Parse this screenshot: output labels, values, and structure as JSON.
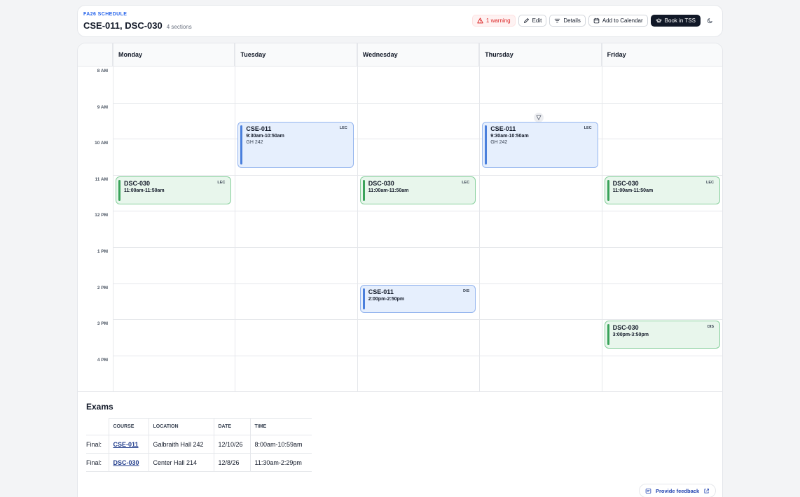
{
  "header": {
    "eyebrow": "FA26 SCHEDULE",
    "title": "CSE-011, DSC-030",
    "subtitle": "4 sections",
    "warning_label": "1 warning",
    "edit_label": "Edit",
    "details_label": "Details",
    "calendar_label": "Add to Calendar",
    "book_label": "Book in TSS"
  },
  "calendar": {
    "days": [
      "Monday",
      "Tuesday",
      "Wednesday",
      "Thursday",
      "Friday"
    ],
    "hours": [
      "8 AM",
      "9 AM",
      "10 AM",
      "11 AM",
      "12 PM",
      "1 PM",
      "2 PM",
      "3 PM",
      "4 PM"
    ],
    "events": [
      {
        "course": "CSE-011",
        "type": "LEC",
        "time": "9:30am-10:50am",
        "location": "GH 242",
        "day": "Tuesday"
      },
      {
        "course": "CSE-011",
        "type": "LEC",
        "time": "9:30am-10:50am",
        "location": "GH 242",
        "day": "Thursday"
      },
      {
        "course": "DSC-030",
        "type": "LEC",
        "time": "11:00am-11:50am",
        "day": "Monday"
      },
      {
        "course": "DSC-030",
        "type": "LEC",
        "time": "11:00am-11:50am",
        "day": "Wednesday"
      },
      {
        "course": "DSC-030",
        "type": "LEC",
        "time": "11:00am-11:50am",
        "day": "Friday"
      },
      {
        "course": "CSE-011",
        "type": "DIS",
        "time": "2:00pm-2:50pm",
        "day": "Wednesday"
      },
      {
        "course": "DSC-030",
        "type": "DIS",
        "time": "3:00pm-3:50pm",
        "day": "Friday"
      }
    ]
  },
  "exams": {
    "title": "Exams",
    "headers": [
      "COURSE",
      "LOCATION",
      "DATE",
      "TIME"
    ],
    "rows": [
      {
        "kind": "Final:",
        "course": "CSE-011",
        "location": "Galbraith Hall 242",
        "date": "12/10/26",
        "time": "8:00am-10:59am"
      },
      {
        "kind": "Final:",
        "course": "DSC-030",
        "location": "Center Hall 214",
        "date": "12/8/26",
        "time": "11:30am-2:29pm"
      }
    ]
  },
  "feedback_label": "Provide feedback",
  "colors": {
    "accent": "#2563eb",
    "warning": "#dc2626",
    "lecture_fill": "#e6effd",
    "discussion_fill": "#e8f6ec"
  },
  "icons": [
    "warning-icon",
    "pencil-icon",
    "filter-icon",
    "calendar-icon",
    "graduation-cap-icon",
    "moon-icon",
    "message-icon",
    "external-link-icon"
  ]
}
